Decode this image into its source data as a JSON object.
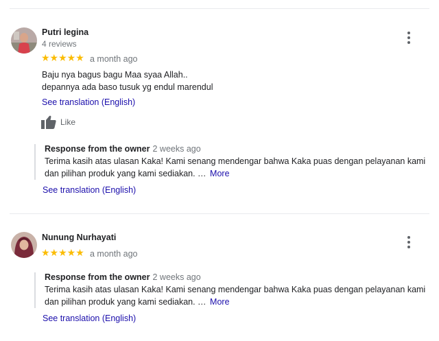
{
  "reviews": [
    {
      "name": "Putri legina",
      "review_count": "4 reviews",
      "stars": "★★★★★",
      "rating": 5,
      "date": "a month ago",
      "text_line1": "Baju nya bagus bagu Maa syaa Allah..",
      "text_line2": "depannya ada baso tusuk yg endul marendul",
      "translate_label": "See translation (English)",
      "like_label": "Like",
      "response": {
        "title": "Response from the owner",
        "date": "2 weeks ago",
        "text_line1": "Terima kasih atas ulasan Kaka! Kami senang mendengar bahwa Kaka puas dengan pelayanan kami",
        "text_line2": "dan pilihan produk yang kami sediakan. …",
        "more_label": "More",
        "translate_label": "See translation (English)"
      }
    },
    {
      "name": "Nunung Nurhayati",
      "stars": "★★★★★",
      "rating": 5,
      "date": "a month ago",
      "response": {
        "title": "Response from the owner",
        "date": "2 weeks ago",
        "text_line1": "Terima kasih atas ulasan Kaka! Kami senang mendengar bahwa Kaka puas dengan pelayanan kami",
        "text_line2": "dan pilihan produk yang kami sediakan. …",
        "more_label": "More",
        "translate_label": "See translation (English)"
      }
    }
  ],
  "colors": {
    "star": "#fbbc04",
    "link": "#1a0dab",
    "secondary_text": "#70757a"
  }
}
